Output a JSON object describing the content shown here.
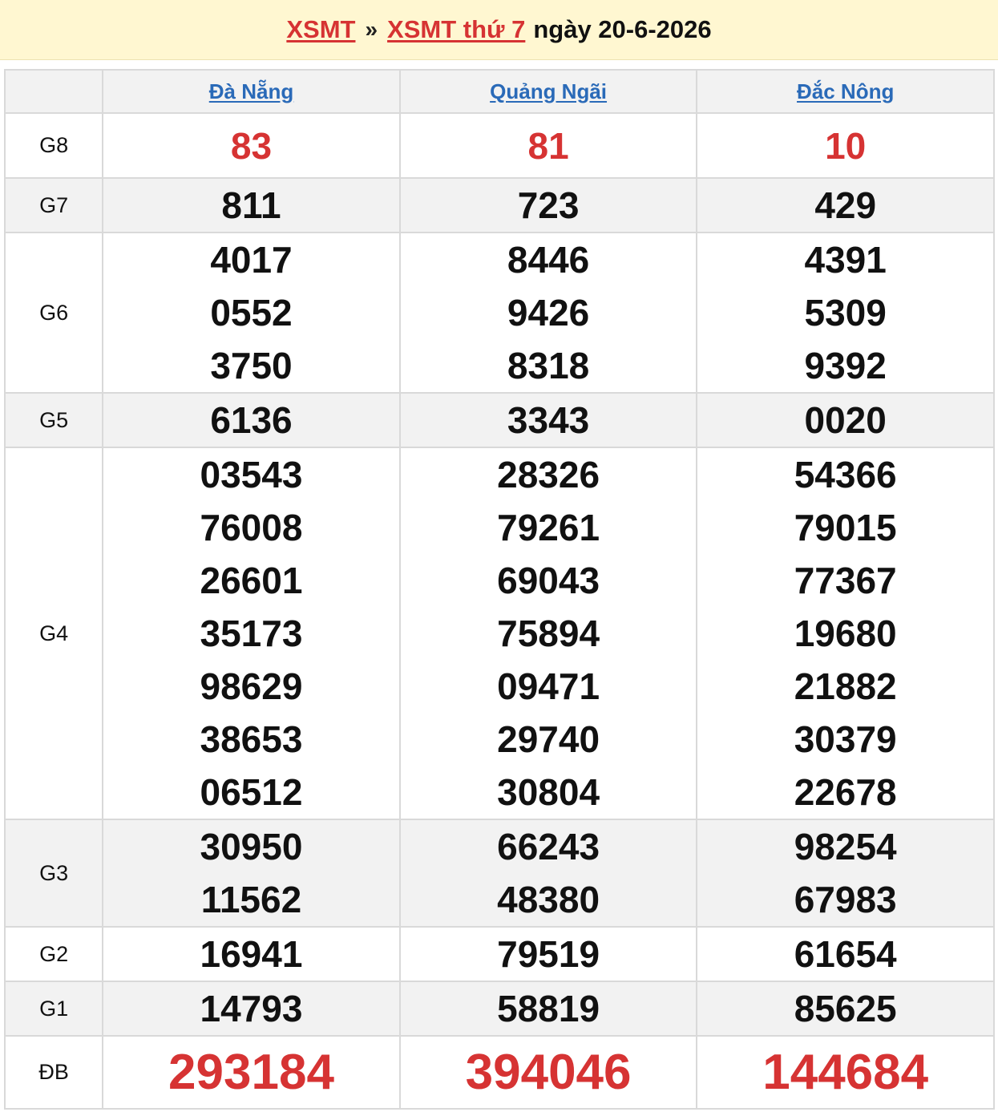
{
  "header": {
    "link1": "XSMT",
    "separator": "»",
    "link2": "XSMT thứ 7",
    "date_text": "ngày 20-6-2026"
  },
  "provinces": [
    "Đà Nẵng",
    "Quảng Ngãi",
    "Đắc Nông"
  ],
  "rows": [
    {
      "label": "G8",
      "values": [
        [
          "83"
        ],
        [
          "81"
        ],
        [
          "10"
        ]
      ]
    },
    {
      "label": "G7",
      "values": [
        [
          "811"
        ],
        [
          "723"
        ],
        [
          "429"
        ]
      ]
    },
    {
      "label": "G6",
      "values": [
        [
          "4017",
          "0552",
          "3750"
        ],
        [
          "8446",
          "9426",
          "8318"
        ],
        [
          "4391",
          "5309",
          "9392"
        ]
      ]
    },
    {
      "label": "G5",
      "values": [
        [
          "6136"
        ],
        [
          "3343"
        ],
        [
          "0020"
        ]
      ]
    },
    {
      "label": "G4",
      "values": [
        [
          "03543",
          "76008",
          "26601",
          "35173",
          "98629",
          "38653",
          "06512"
        ],
        [
          "28326",
          "79261",
          "69043",
          "75894",
          "09471",
          "29740",
          "30804"
        ],
        [
          "54366",
          "79015",
          "77367",
          "19680",
          "21882",
          "30379",
          "22678"
        ]
      ]
    },
    {
      "label": "G3",
      "values": [
        [
          "30950",
          "11562"
        ],
        [
          "66243",
          "48380"
        ],
        [
          "98254",
          "67983"
        ]
      ]
    },
    {
      "label": "G2",
      "values": [
        [
          "16941"
        ],
        [
          "79519"
        ],
        [
          "61654"
        ]
      ]
    },
    {
      "label": "G1",
      "values": [
        [
          "14793"
        ],
        [
          "58819"
        ],
        [
          "85625"
        ]
      ]
    },
    {
      "label": "ĐB",
      "values": [
        [
          "293184"
        ],
        [
          "394046"
        ],
        [
          "144684"
        ]
      ]
    }
  ],
  "colors": {
    "header_bg": "#fff7d1",
    "red": "#d63333",
    "link_blue": "#2a6ab8",
    "row_alt_bg": "#f2f2f2",
    "border": "#d9d9d9"
  }
}
